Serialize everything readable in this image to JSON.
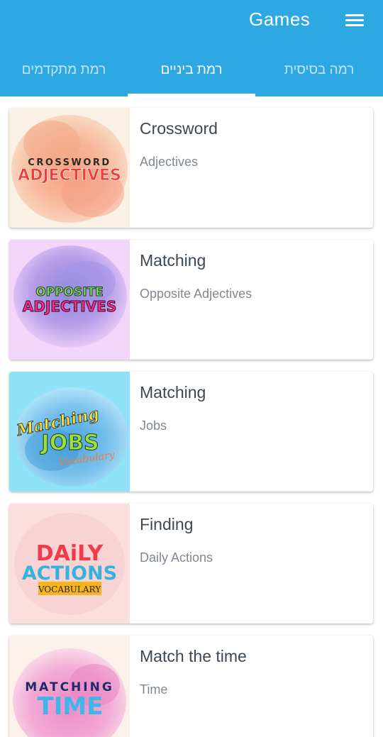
{
  "header": {
    "title": "Games",
    "icon": "hamburger-menu-icon"
  },
  "tabs": [
    {
      "label": "רמה בסיסית",
      "active": false
    },
    {
      "label": "רמת ביניים",
      "active": true
    },
    {
      "label": "רמת מתקדמים",
      "active": false
    }
  ],
  "colors": {
    "primary": "#2ea8e3",
    "title_text": "#3d4750",
    "subtitle_text": "#808890"
  },
  "games": [
    {
      "title": "Crossword",
      "subtitle": "Adjectives",
      "thumb_line1": "CROSSWORD",
      "thumb_line2": "ADJECTIVES"
    },
    {
      "title": "Matching",
      "subtitle": "Opposite Adjectives",
      "thumb_line1": "OPPOSITE",
      "thumb_line2": "ADJECTIVES"
    },
    {
      "title": "Matching",
      "subtitle": "Jobs",
      "thumb_line1": "Matching",
      "thumb_line2": "JOBS",
      "thumb_line3": "Vocabulary"
    },
    {
      "title": "Finding",
      "subtitle": "Daily Actions",
      "thumb_line1": "DAiLY",
      "thumb_line2": "ACTIONS",
      "thumb_line3": "VOCABULARY"
    },
    {
      "title": "Match the time",
      "subtitle": "Time",
      "thumb_line1": "MATCHING",
      "thumb_line2": "TIME"
    }
  ]
}
